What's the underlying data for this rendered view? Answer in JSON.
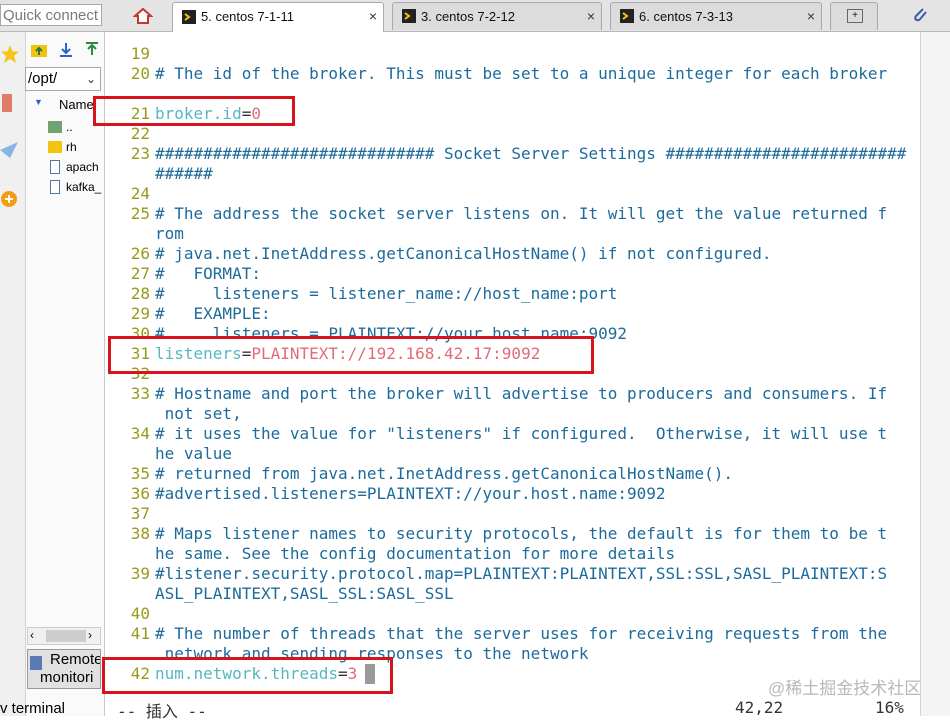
{
  "quick_connect": {
    "placeholder": "Quick connect"
  },
  "tabs": [
    {
      "label": "5. centos 7-1-11",
      "active": true
    },
    {
      "label": "3. centos 7-2-12",
      "active": false
    },
    {
      "label": "6. centos 7-3-13",
      "active": false
    }
  ],
  "file_pane": {
    "path": "/opt/",
    "column_header": "Name",
    "items": [
      "..",
      "rh",
      "apach",
      "kafka_"
    ],
    "remote_monitor_label_1": "Remote",
    "remote_monitor_label_2": "monitori",
    "bottom_label": "v terminal"
  },
  "terminal": {
    "lines": [
      {
        "n": "19",
        "t": ""
      },
      {
        "n": "20",
        "t": "# The id of the broker. This must be set to a unique integer for each broker"
      },
      {
        "n": "",
        "t": "."
      },
      {
        "n": "21",
        "k": "broker.id",
        "eq": "=",
        "v": "0"
      },
      {
        "n": "22",
        "t": ""
      },
      {
        "n": "23",
        "t": "############################# Socket Server Settings #########################"
      },
      {
        "n": "",
        "t": "######"
      },
      {
        "n": "24",
        "t": ""
      },
      {
        "n": "25",
        "t": "# The address the socket server listens on. It will get the value returned f"
      },
      {
        "n": "",
        "t": "rom"
      },
      {
        "n": "26",
        "t": "# java.net.InetAddress.getCanonicalHostName() if not configured."
      },
      {
        "n": "27",
        "t": "#   FORMAT:"
      },
      {
        "n": "28",
        "t": "#     listeners = listener_name://host_name:port"
      },
      {
        "n": "29",
        "t": "#   EXAMPLE:"
      },
      {
        "n": "30",
        "t": "#     listeners = PLAINTEXT://your.host.name:9092"
      },
      {
        "n": "31",
        "k": "listeners",
        "eq": "=",
        "v": "PLAINTEXT://192.168.42.17:9092"
      },
      {
        "n": "32",
        "t": ""
      },
      {
        "n": "33",
        "t": "# Hostname and port the broker will advertise to producers and consumers. If"
      },
      {
        "n": "",
        "t": " not set,"
      },
      {
        "n": "34",
        "t": "# it uses the value for \"listeners\" if configured.  Otherwise, it will use t"
      },
      {
        "n": "",
        "t": "he value"
      },
      {
        "n": "35",
        "t": "# returned from java.net.InetAddress.getCanonicalHostName()."
      },
      {
        "n": "36",
        "t": "#advertised.listeners=PLAINTEXT://your.host.name:9092"
      },
      {
        "n": "37",
        "t": ""
      },
      {
        "n": "38",
        "t": "# Maps listener names to security protocols, the default is for them to be t"
      },
      {
        "n": "",
        "t": "he same. See the config documentation for more details"
      },
      {
        "n": "39",
        "t": "#listener.security.protocol.map=PLAINTEXT:PLAINTEXT,SSL:SSL,SASL_PLAINTEXT:S"
      },
      {
        "n": "",
        "t": "ASL_PLAINTEXT,SASL_SSL:SASL_SSL"
      },
      {
        "n": "40",
        "t": ""
      },
      {
        "n": "41",
        "t": "# The number of threads that the server uses for receiving requests from the"
      },
      {
        "n": "",
        "t": " network and sending responses to the network"
      },
      {
        "n": "42",
        "k": "num.network.threads",
        "eq": "=",
        "v": "3"
      }
    ],
    "status_mode": "-- 插入 --",
    "status_pos": "42,22",
    "status_pct": "16%"
  },
  "watermark": "@稀土掘金技术社区",
  "colors": {
    "highlight_box": "#d7141e",
    "key": "#56b6c2",
    "value": "#e06c75",
    "comment": "#1d6b9b",
    "line_number": "#9a9a1a"
  }
}
